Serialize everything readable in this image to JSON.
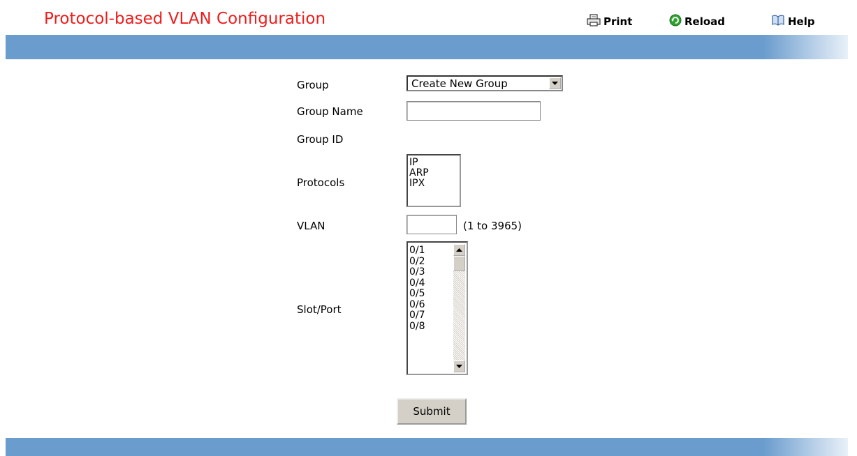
{
  "header": {
    "title": "Protocol-based VLAN Configuration",
    "print_label": "Print",
    "reload_label": "Reload",
    "help_label": "Help",
    "icons": {
      "print": "printer-icon",
      "reload": "reload-icon",
      "help": "book-icon"
    },
    "colors": {
      "title": "#ee1c1c",
      "bar": "#6a9ccd",
      "reload_icon": "#2fa32f"
    }
  },
  "form": {
    "group": {
      "label": "Group",
      "selected": "Create New Group"
    },
    "group_name": {
      "label": "Group Name",
      "value": ""
    },
    "group_id": {
      "label": "Group ID",
      "value": ""
    },
    "protocols": {
      "label": "Protocols",
      "options": [
        "IP",
        "ARP",
        "IPX"
      ]
    },
    "vlan": {
      "label": "VLAN",
      "value": "",
      "range_hint": "(1 to 3965)"
    },
    "slot_port": {
      "label": "Slot/Port",
      "options": [
        "0/1",
        "0/2",
        "0/3",
        "0/4",
        "0/5",
        "0/6",
        "0/7",
        "0/8"
      ]
    },
    "submit_label": "Submit"
  }
}
